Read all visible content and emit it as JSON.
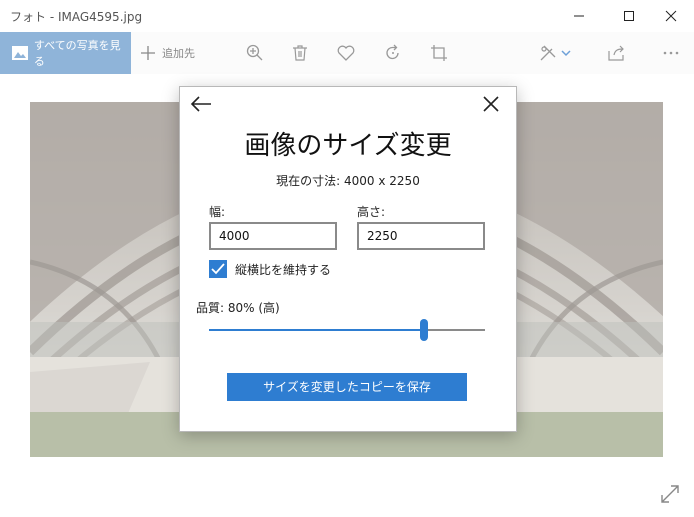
{
  "window": {
    "title": "フォト - IMAG4595.jpg"
  },
  "toolbar": {
    "all_photos_label": "すべての写真を見る",
    "add_label": "追加先"
  },
  "dialog": {
    "title": "画像のサイズ変更",
    "current_dims": "現在の寸法: 4000 x 2250",
    "width_label": "幅:",
    "width_value": "4000",
    "height_label": "高さ:",
    "height_value": "2250",
    "keep_ratio_label": "縦横比を維持する",
    "keep_ratio_checked": true,
    "quality_label": "品質: 80% (高)",
    "quality_value": 0.78,
    "save_button_label": "サイズを変更したコピーを保存"
  },
  "colors": {
    "accent": "#2e7dd1",
    "all_photos_bg": "#8fb4d9"
  }
}
